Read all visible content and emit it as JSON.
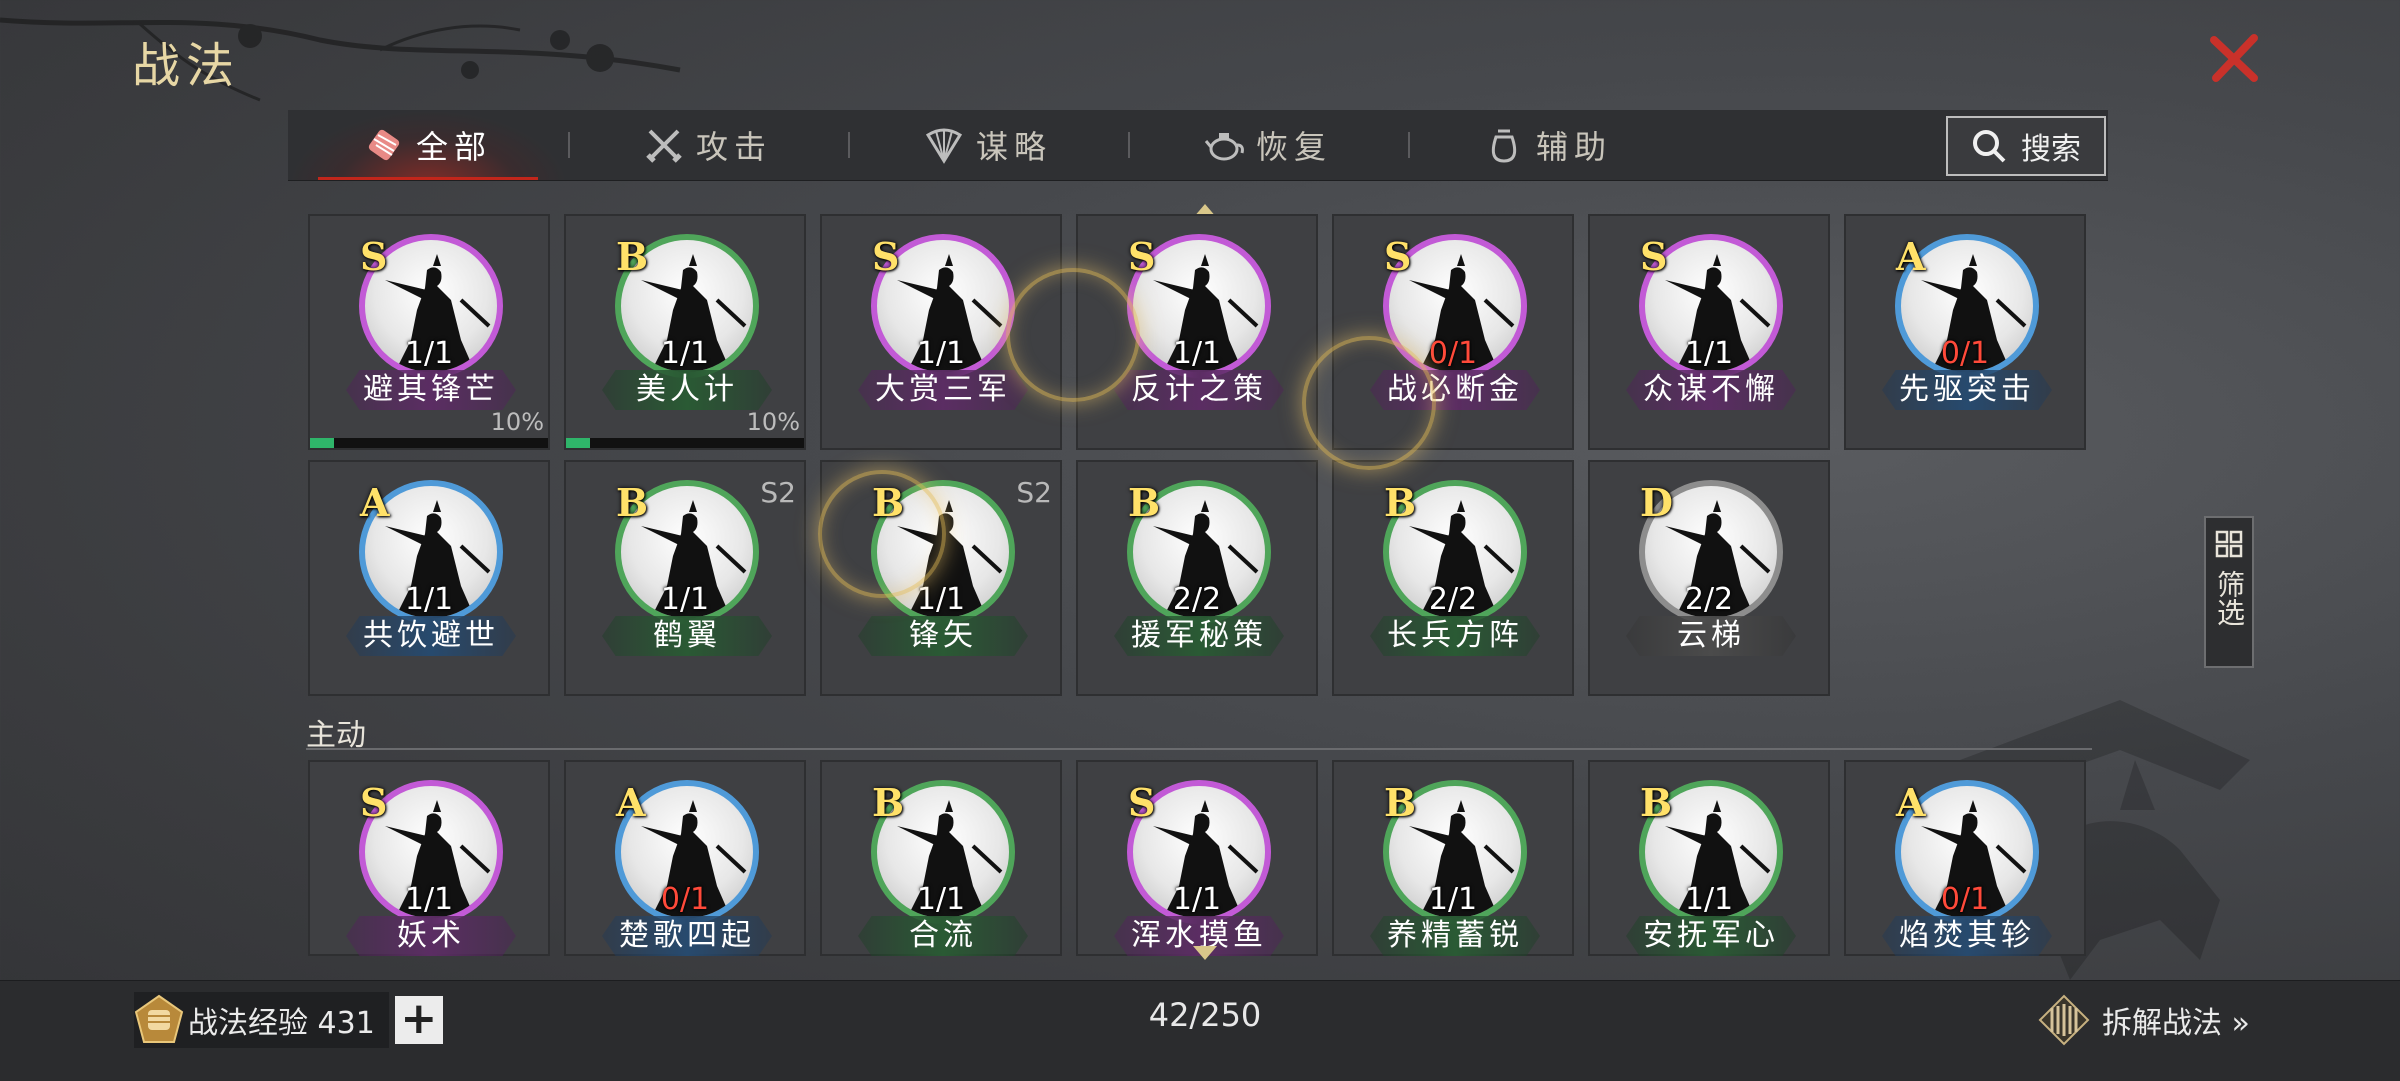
{
  "page": {
    "title": "战法"
  },
  "tabs": [
    {
      "label": "全部",
      "icon": "scroll-bundle-icon",
      "active": true
    },
    {
      "label": "攻击",
      "icon": "crossed-swords-icon",
      "active": false
    },
    {
      "label": "谋略",
      "icon": "fan-icon",
      "active": false
    },
    {
      "label": "恢复",
      "icon": "teapot-icon",
      "active": false
    },
    {
      "label": "辅助",
      "icon": "pouch-icon",
      "active": false
    }
  ],
  "search": {
    "label": "搜索"
  },
  "filter": {
    "label": "筛选"
  },
  "section": {
    "active_label": "主动"
  },
  "cards": [
    {
      "grade": "S",
      "count": "1/1",
      "name": "避其锋芒",
      "progress_pct": "10%",
      "progress": 0.1
    },
    {
      "grade": "B",
      "count": "1/1",
      "name": "美人计",
      "progress_pct": "10%",
      "progress": 0.1
    },
    {
      "grade": "S",
      "count": "1/1",
      "name": "大赏三军"
    },
    {
      "grade": "S",
      "count": "1/1",
      "name": "反计之策"
    },
    {
      "grade": "S",
      "count": "0/1",
      "name": "战必断金"
    },
    {
      "grade": "S",
      "count": "1/1",
      "name": "众谋不懈"
    },
    {
      "grade": "A",
      "count": "0/1",
      "name": "先驱突击"
    },
    {
      "grade": "A",
      "count": "1/1",
      "name": "共饮避世"
    },
    {
      "grade": "B",
      "count": "1/1",
      "name": "鹤翼",
      "season": "S2"
    },
    {
      "grade": "B",
      "count": "1/1",
      "name": "锋矢",
      "season": "S2"
    },
    {
      "grade": "B",
      "count": "2/2",
      "name": "援军秘策"
    },
    {
      "grade": "B",
      "count": "2/2",
      "name": "长兵方阵"
    },
    {
      "grade": "D",
      "count": "2/2",
      "name": "云梯"
    },
    {
      "grade": "S",
      "count": "1/1",
      "name": "妖术"
    },
    {
      "grade": "A",
      "count": "0/1",
      "name": "楚歌四起"
    },
    {
      "grade": "B",
      "count": "1/1",
      "name": "合流"
    },
    {
      "grade": "S",
      "count": "1/1",
      "name": "浑水摸鱼"
    },
    {
      "grade": "B",
      "count": "1/1",
      "name": "养精蓄锐"
    },
    {
      "grade": "B",
      "count": "1/1",
      "name": "安抚军心"
    },
    {
      "grade": "A",
      "count": "0/1",
      "name": "焰焚其轸"
    }
  ],
  "footer": {
    "exp_label": "战法经验 431",
    "plus": "+",
    "capacity": "42/250",
    "dismantle_label": "拆解战法 »"
  },
  "colors": {
    "grade_S": "#c25ad6",
    "grade_A": "#4f9ad8",
    "grade_B": "#4fa55a",
    "grade_D": "#8d8d8d",
    "grade_text": "#ffe169",
    "zero_count": "#ff4a3a",
    "tab_active": "#c2261b",
    "title": "#e7d7a5"
  }
}
